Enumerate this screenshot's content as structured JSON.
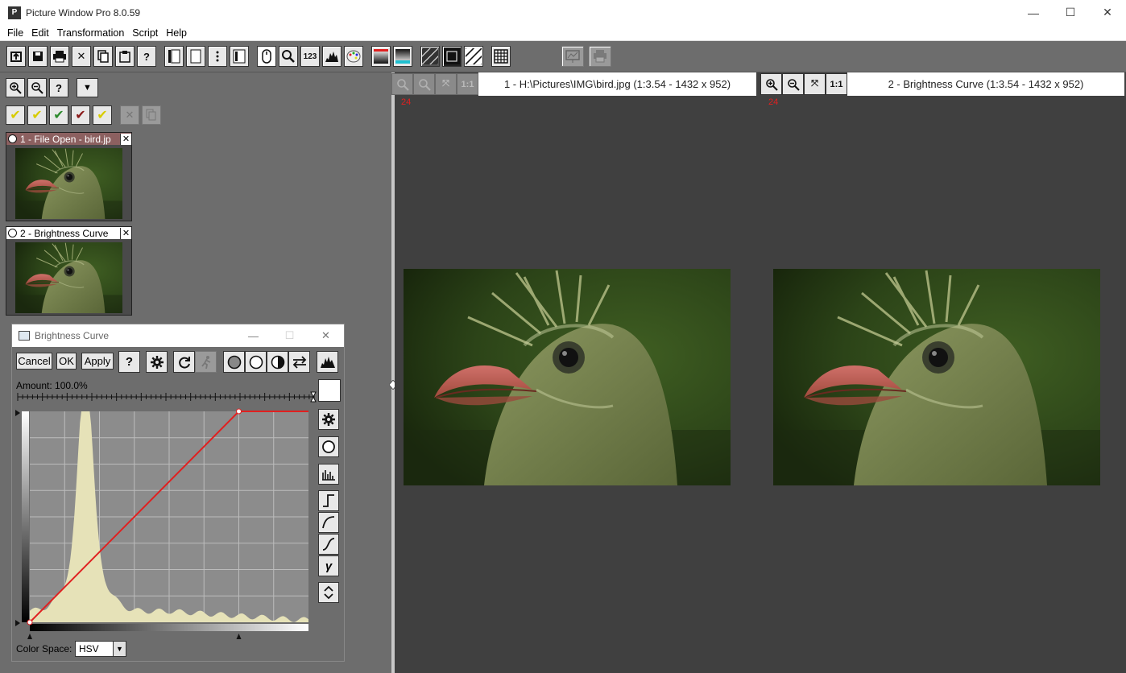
{
  "app": {
    "title": "Picture Window Pro 8.0.59",
    "icon_label": "P"
  },
  "window_controls": {
    "minimize": "—",
    "maximize": "☐",
    "close": "✕"
  },
  "menu": [
    "File",
    "Edit",
    "Transformation",
    "Script",
    "Help"
  ],
  "toolbar_icons": [
    "open-icon",
    "save-icon",
    "print-icon",
    "close-icon",
    "copy-icon",
    "paste-icon",
    "help-icon",
    "layout-filmstrip-icon",
    "layout-single-icon",
    "layout-dots-icon",
    "layout-panel-icon",
    "mouse-icon",
    "magnifier-icon",
    "numbers-icon",
    "histogram-icon",
    "palette-icon",
    "color-red-icon",
    "color-cyan-icon",
    "mask-stripes-icon",
    "mask-black-icon",
    "mask-white-icon",
    "grid-icon",
    "slideshow-icon",
    "printer-icon"
  ],
  "toolbar_texts": {
    "help": "?",
    "numbers": "123",
    "close": "✕"
  },
  "left_panel": {
    "zoom_in": "+",
    "zoom_out": "−",
    "help": "?",
    "dropdown": "▼",
    "check_buttons": [
      "✔",
      "✔",
      "✔",
      "✔",
      "✔"
    ],
    "thumbnails": [
      {
        "title": "1 - File Open - bird.jp",
        "close": "✕",
        "active": true
      },
      {
        "title": "2 - Brightness Curve",
        "close": "✕",
        "active": false
      }
    ]
  },
  "dialog": {
    "title": "Brightness Curve",
    "buttons": {
      "cancel": "Cancel",
      "ok": "OK",
      "apply": "Apply",
      "help": "?"
    },
    "amount_label": "Amount: 100.0%",
    "color_space_label": "Color Space:",
    "color_space_value": "HSV",
    "curve_points": [
      [
        0,
        0
      ],
      [
        0.75,
        1
      ],
      [
        1,
        1
      ]
    ],
    "histogram_peak_fraction": 0.2
  },
  "viewers": [
    {
      "title": "1 - H:\\Pictures\\IMG\\bird.jpg (1:3.54 - 1432 x 952)",
      "zoom_label": "24",
      "buttons_enabled": false
    },
    {
      "title": "2 - Brightness Curve (1:3.54 - 1432 x 952)",
      "zoom_label": "24",
      "buttons_enabled": true
    }
  ],
  "viewer_button_labels": {
    "zoom_in": "+",
    "zoom_out": "−",
    "fit": "⤧",
    "one_to_one": "1:1"
  },
  "colors": {
    "panel_gray": "#6d6d6d",
    "viewer_bg": "#404040",
    "curve_red": "#e02020",
    "histogram_fill": "#e6e2b8",
    "active_thumb_header": "#8c6060"
  }
}
